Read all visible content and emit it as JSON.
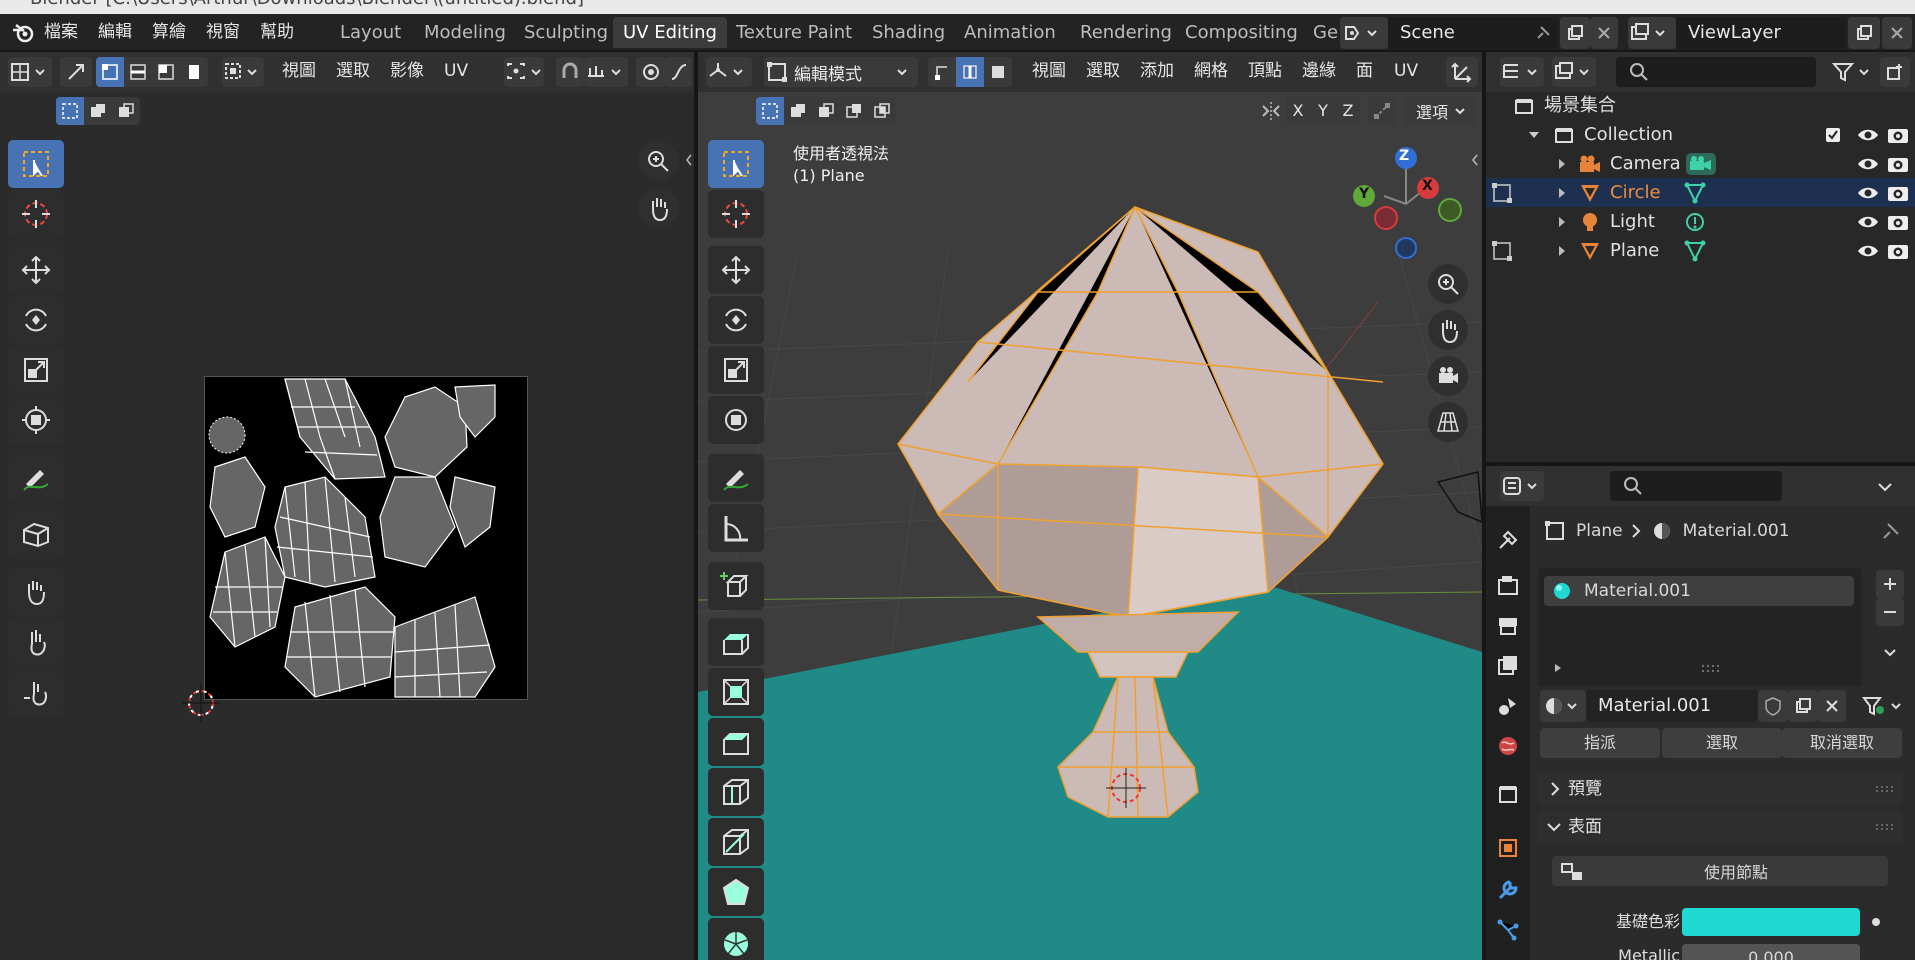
{
  "window": {
    "title": "Blender  [C:\\Users\\Arthur\\Downloads\\Blender\\(untitled).blend]"
  },
  "menubar": {
    "items": [
      "檔案",
      "編輯",
      "算繪",
      "視窗",
      "幫助"
    ]
  },
  "workspaces": {
    "tabs": [
      "Layout",
      "Modeling",
      "Sculpting",
      "UV Editing",
      "Texture Paint",
      "Shading",
      "Animation",
      "Rendering",
      "Compositing",
      "Ge"
    ],
    "active": "UV Editing"
  },
  "scene": {
    "name": "Scene"
  },
  "view_layer": {
    "name": "ViewLayer"
  },
  "uv_editor": {
    "menus": [
      "視圖",
      "選取",
      "影像",
      "UV"
    ]
  },
  "viewport": {
    "mode": "編輯模式",
    "menus": [
      "視圖",
      "選取",
      "添加",
      "網格",
      "頂點",
      "邊緣",
      "面",
      "UV"
    ],
    "axes": [
      "X",
      "Y",
      "Z"
    ],
    "options_label": "選項",
    "view_name": "使用者透視法",
    "object_info": "(1) Plane",
    "gizmo": {
      "x": "X",
      "y": "Y",
      "z": "Z"
    },
    "colors": {
      "floor": "#1f8a86",
      "mesh": "#cbbab5",
      "edge": "#f0a030"
    }
  },
  "outliner": {
    "root": "場景集合",
    "collection": "Collection",
    "items": [
      {
        "name": "Camera",
        "icon": "camera-icon",
        "selected": false
      },
      {
        "name": "Circle",
        "icon": "mesh-icon",
        "selected": true
      },
      {
        "name": "Light",
        "icon": "light-icon",
        "selected": false
      },
      {
        "name": "Plane",
        "icon": "mesh-icon",
        "selected": false
      }
    ]
  },
  "properties": {
    "breadcrumb": {
      "object": "Plane",
      "material": "Material.001"
    },
    "slot": "Material.001",
    "datablock": "Material.001",
    "buttons": [
      "指派",
      "選取",
      "取消選取"
    ],
    "sections": {
      "preview": "預覽",
      "surface": "表面"
    },
    "use_nodes": "使用節點",
    "base_color_label": "基礎色彩",
    "base_color": "#1fd8d2",
    "metallic_label": "Metallic",
    "metallic_value": "0.000"
  }
}
